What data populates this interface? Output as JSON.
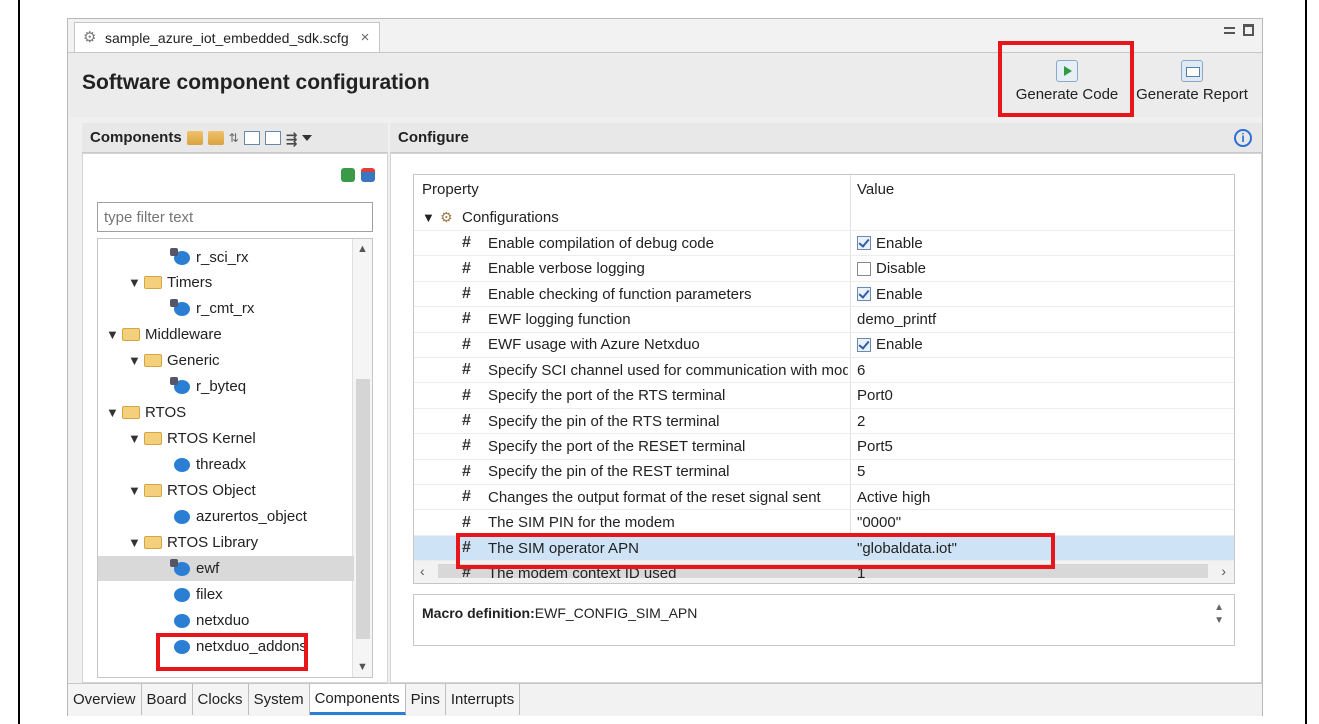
{
  "editor": {
    "file_tab": "sample_azure_iot_embedded_sdk.scfg",
    "title": "Software component configuration",
    "generate_code": "Generate Code",
    "generate_report": "Generate Report"
  },
  "components": {
    "header": "Components",
    "filter_placeholder": "type filter text",
    "tree": [
      {
        "label": "r_sci_rx",
        "kind": "config-module",
        "level": 3
      },
      {
        "label": "Timers",
        "kind": "folder",
        "level": 2,
        "expanded": true
      },
      {
        "label": "r_cmt_rx",
        "kind": "config-module",
        "level": 3
      },
      {
        "label": "Middleware",
        "kind": "folder",
        "level": 1,
        "expanded": true
      },
      {
        "label": "Generic",
        "kind": "folder",
        "level": 2,
        "expanded": true
      },
      {
        "label": "r_byteq",
        "kind": "config-module",
        "level": 3
      },
      {
        "label": "RTOS",
        "kind": "folder",
        "level": 1,
        "expanded": true
      },
      {
        "label": "RTOS Kernel",
        "kind": "folder",
        "level": 2,
        "expanded": true
      },
      {
        "label": "threadx",
        "kind": "module",
        "level": 3
      },
      {
        "label": "RTOS Object",
        "kind": "folder",
        "level": 2,
        "expanded": true
      },
      {
        "label": "azurertos_object",
        "kind": "module",
        "level": 3
      },
      {
        "label": "RTOS Library",
        "kind": "folder",
        "level": 2,
        "expanded": true
      },
      {
        "label": "ewf",
        "kind": "config-module",
        "level": 3,
        "selected": true
      },
      {
        "label": "filex",
        "kind": "module",
        "level": 3
      },
      {
        "label": "netxduo",
        "kind": "module",
        "level": 3
      },
      {
        "label": "netxduo_addons",
        "kind": "module",
        "level": 3
      }
    ]
  },
  "configure": {
    "header": "Configure",
    "col_property": "Property",
    "col_value": "Value",
    "group": "Configurations",
    "rows": [
      {
        "property": "Enable compilation of debug code",
        "value": "Enable",
        "checkbox": true,
        "checked": true
      },
      {
        "property": "Enable verbose logging",
        "value": "Disable",
        "checkbox": true,
        "checked": false
      },
      {
        "property": "Enable checking of function parameters",
        "value": "Enable",
        "checkbox": true,
        "checked": true
      },
      {
        "property": "EWF logging function",
        "value": "demo_printf"
      },
      {
        "property": "EWF usage with Azure Netxduo",
        "value": "Enable",
        "checkbox": true,
        "checked": true
      },
      {
        "property": "Specify SCI channel used for communication with modem",
        "value": "6"
      },
      {
        "property": "Specify the port of the RTS terminal",
        "value": "Port0"
      },
      {
        "property": "Specify the pin of the RTS terminal",
        "value": "2"
      },
      {
        "property": "Specify the port of the RESET terminal",
        "value": "Port5"
      },
      {
        "property": "Specify the pin of the REST terminal",
        "value": "5"
      },
      {
        "property": "Changes the output format of the reset signal sent",
        "value": "Active high"
      },
      {
        "property": "The SIM PIN for the modem",
        "value": "\"0000\""
      },
      {
        "property": "The SIM operator APN",
        "value": "\"globaldata.iot\"",
        "selected": true
      },
      {
        "property": "The modem context ID used",
        "value": "1"
      }
    ],
    "macro_label": "Macro definition:",
    "macro_value": "EWF_CONFIG_SIM_APN"
  },
  "bottom_tabs": [
    "Overview",
    "Board",
    "Clocks",
    "System",
    "Components",
    "Pins",
    "Interrupts"
  ],
  "active_bottom_tab": "Components",
  "colors": {
    "highlight": "#e8161a",
    "selection": "#cfe3f6",
    "accent": "#2a7fd4"
  }
}
